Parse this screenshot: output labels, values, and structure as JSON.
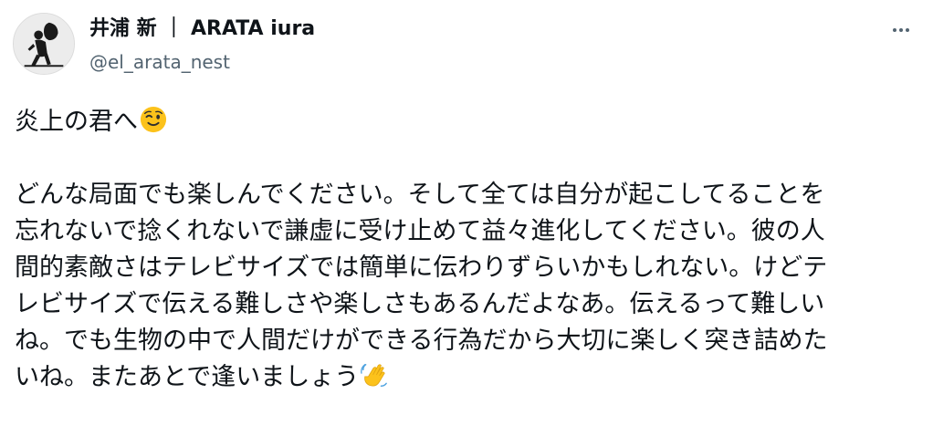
{
  "author": {
    "display_name": "井浦 新 ｜ ARATA iura",
    "handle": "@el_arata_nest"
  },
  "tweet": {
    "line1": "炎上の君へ",
    "line1_emoji": "winking-face-icon",
    "body_lines": [
      "どんな局面でも楽しんでください。そして全ては自分が起こしてることを",
      "忘れないで捻くれないで謙虚に受け止めて益々進化してください。彼の人",
      "間的素敵さはテレビサイズでは簡単に伝わりずらいかもしれない。けどテ",
      "レビサイズで伝える難しさや楽しさもあるんだよなあ。伝えるって難しい",
      "ね。でも生物の中で人間だけができる行為だから大切に楽しく突き詰めた"
    ],
    "last_line": "いね。またあとで逢いましょう",
    "last_line_emoji": "waving-hand-icon"
  },
  "menu": {
    "icon": "more-options-icon"
  },
  "colors": {
    "text": "#0f1419",
    "secondary": "#536471",
    "emoji_yellow": "#fcc21b"
  }
}
